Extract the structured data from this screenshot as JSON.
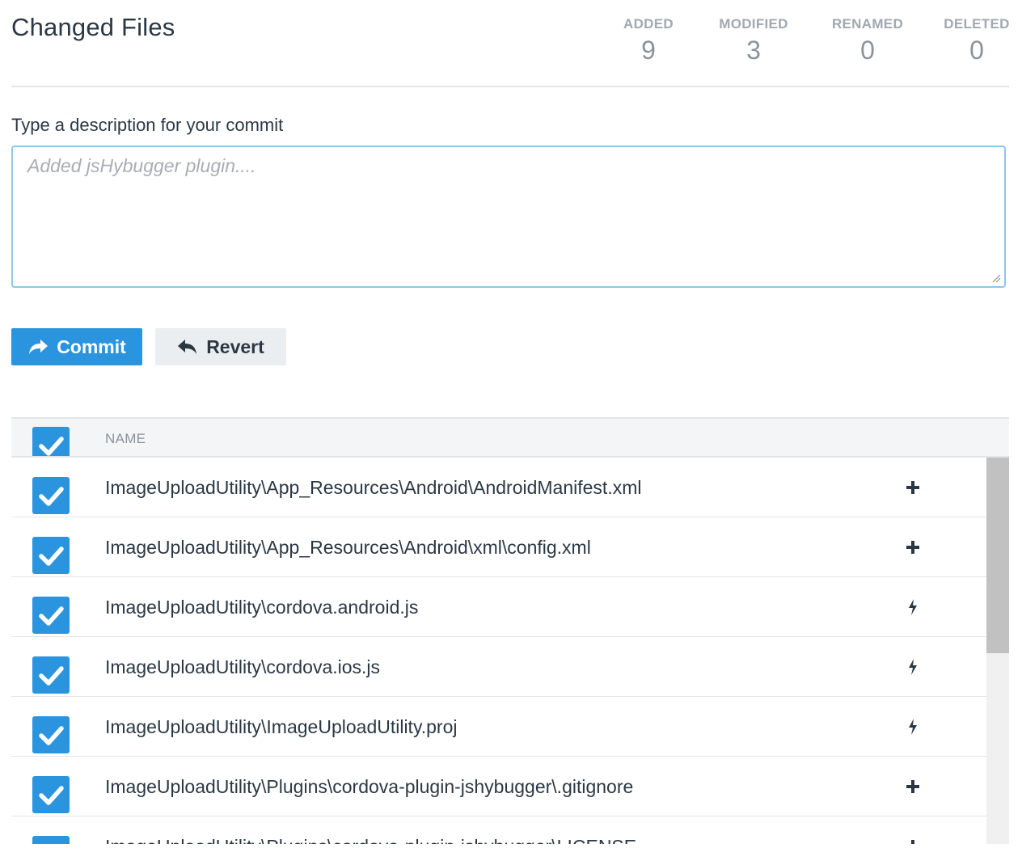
{
  "header": {
    "title": "Changed Files",
    "stats": [
      {
        "label": "ADDED",
        "value": "9"
      },
      {
        "label": "MODIFIED",
        "value": "3"
      },
      {
        "label": "RENAMED",
        "value": "0"
      },
      {
        "label": "DELETED",
        "value": "0"
      }
    ]
  },
  "commit_form": {
    "label": "Type a description for your commit",
    "placeholder": "Added jsHybugger plugin....",
    "value": ""
  },
  "actions": {
    "commit_label": "Commit",
    "revert_label": "Revert"
  },
  "table": {
    "column_name": "NAME",
    "select_all_checked": true,
    "rows": [
      {
        "name": "ImageUploadUtility\\App_Resources\\Android\\AndroidManifest.xml",
        "status": "added",
        "status_icon": "plus-icon",
        "checked": true
      },
      {
        "name": "ImageUploadUtility\\App_Resources\\Android\\xml\\config.xml",
        "status": "added",
        "status_icon": "plus-icon",
        "checked": true
      },
      {
        "name": "ImageUploadUtility\\cordova.android.js",
        "status": "modified",
        "status_icon": "bolt-icon",
        "checked": true
      },
      {
        "name": "ImageUploadUtility\\cordova.ios.js",
        "status": "modified",
        "status_icon": "bolt-icon",
        "checked": true
      },
      {
        "name": "ImageUploadUtility\\ImageUploadUtility.proj",
        "status": "modified",
        "status_icon": "bolt-icon",
        "checked": true
      },
      {
        "name": "ImageUploadUtility\\Plugins\\cordova-plugin-jshybugger\\.gitignore",
        "status": "added",
        "status_icon": "plus-icon",
        "checked": true
      },
      {
        "name": "ImageUploadUtility\\Plugins\\cordova-plugin-jshybugger\\LICENSE",
        "status": "added",
        "status_icon": "plus-icon",
        "checked": true
      }
    ]
  },
  "colors": {
    "accent": "#2b94de",
    "text": "#2b3844",
    "muted": "#8a939c",
    "focus_border": "#8fc6ea",
    "secondary_button": "#ebeef0"
  }
}
